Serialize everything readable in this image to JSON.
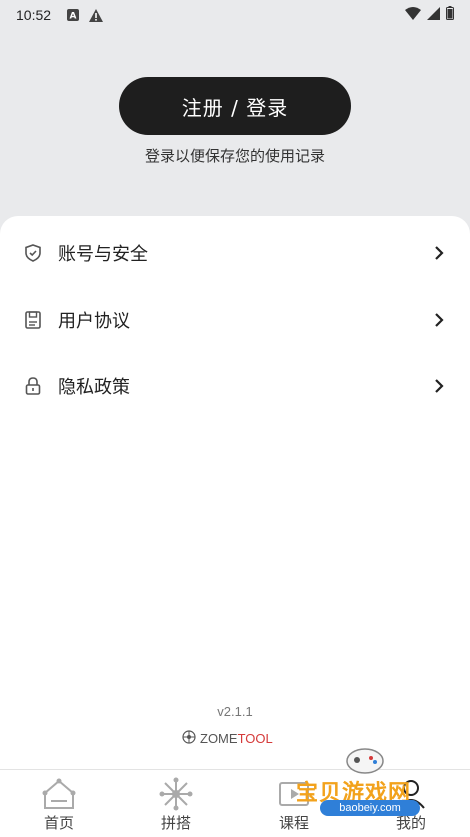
{
  "status_bar": {
    "time": "10:52",
    "icons": [
      "a-notification-icon",
      "warning-icon",
      "wifi-icon",
      "signal-icon",
      "battery-icon"
    ]
  },
  "login": {
    "button_label": "注册 / 登录",
    "hint": "登录以便保存您的使用记录"
  },
  "menu": {
    "items": [
      {
        "label": "账号与安全",
        "icon": "shield-icon"
      },
      {
        "label": "用户协议",
        "icon": "document-icon"
      },
      {
        "label": "隐私政策",
        "icon": "lock-icon"
      }
    ]
  },
  "footer": {
    "version": "v2.1.1",
    "brand_main": "ZOME",
    "brand_accent": "TOOL"
  },
  "tabs": [
    {
      "label": "首页",
      "icon": "home-icon"
    },
    {
      "label": "拼搭",
      "icon": "build-icon"
    },
    {
      "label": "课程",
      "icon": "course-icon"
    },
    {
      "label": "我的",
      "icon": "profile-icon"
    }
  ],
  "watermark": {
    "title": "宝贝游戏网",
    "url": "baobeiy.com"
  },
  "colors": {
    "background": "#e9eaec",
    "button": "#1e1e1e",
    "brand_accent": "#d53a3a"
  }
}
